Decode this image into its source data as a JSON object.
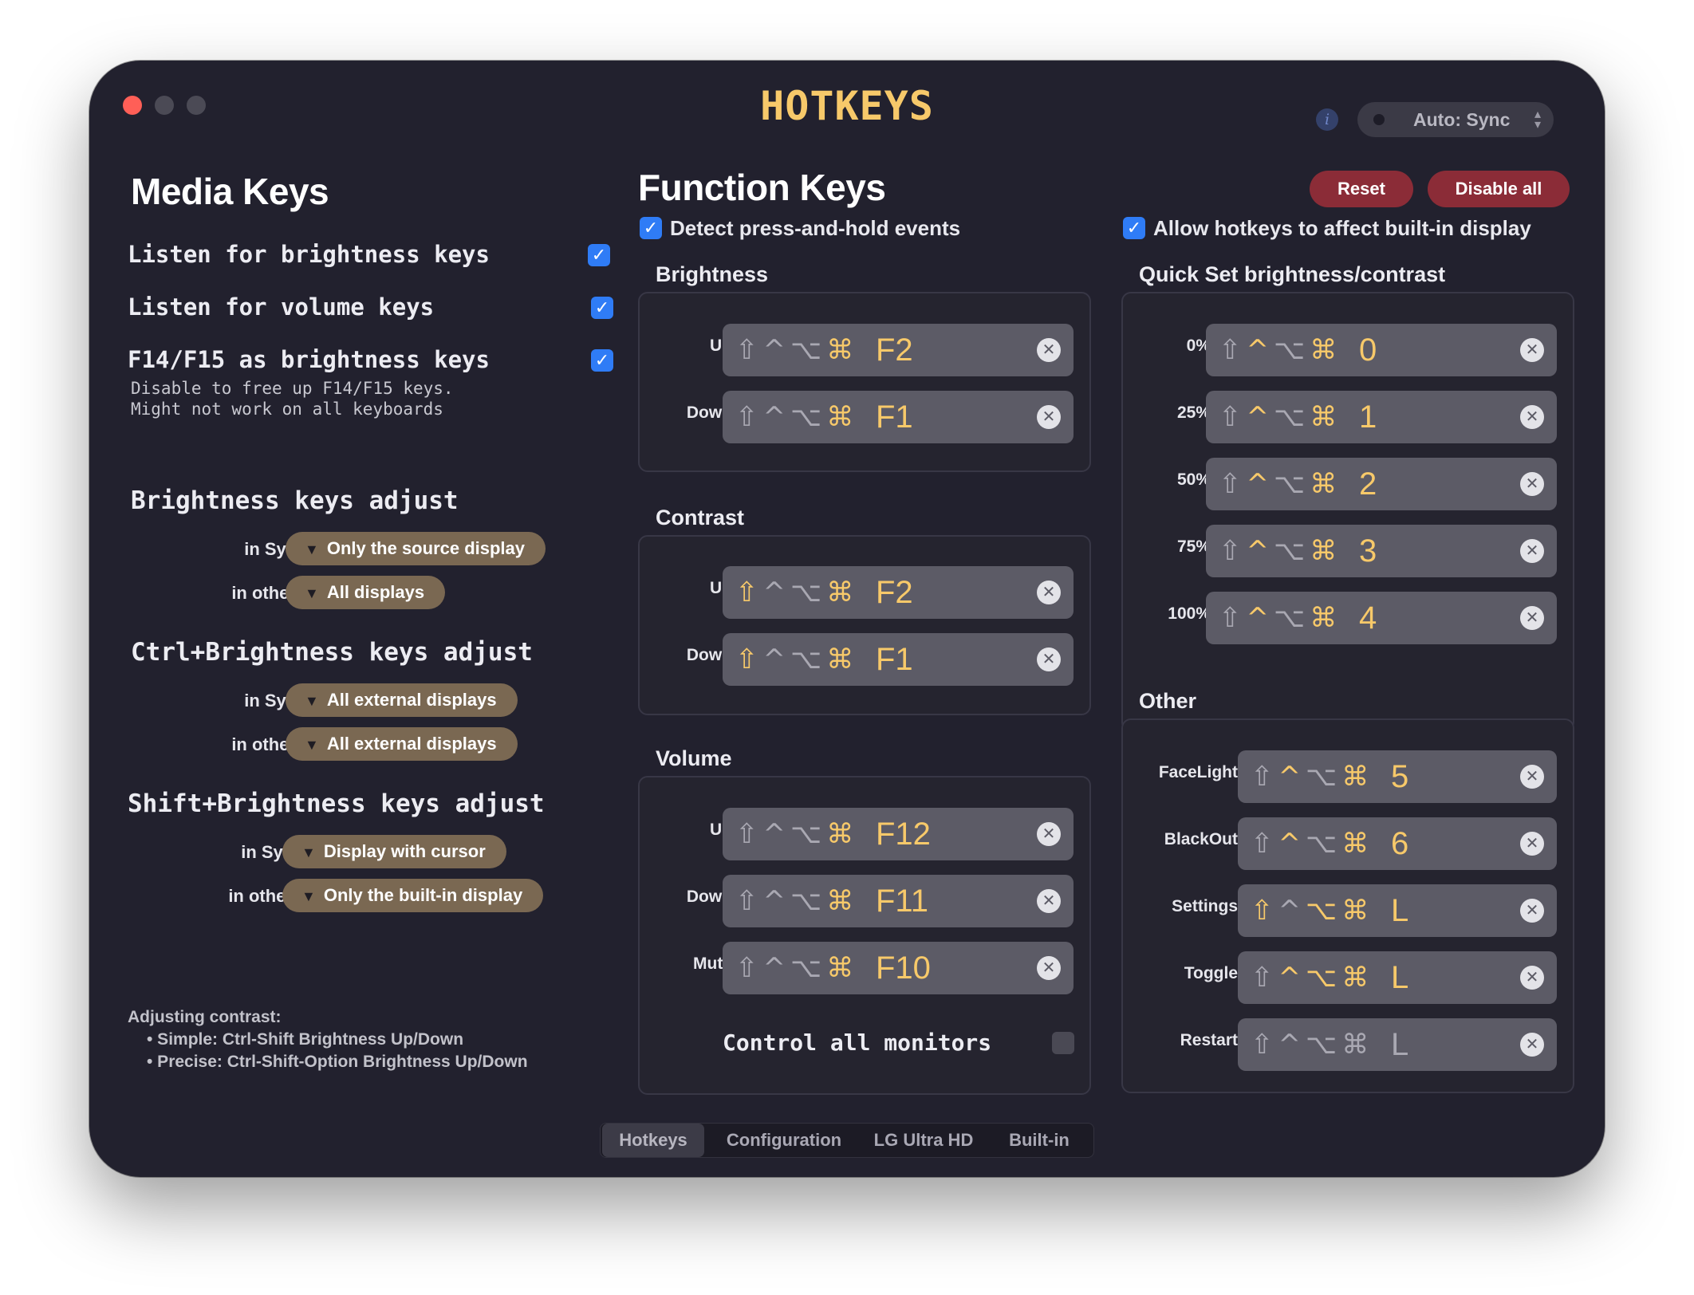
{
  "window": {
    "title": "HOTKEYS"
  },
  "toolbar": {
    "sync_mode": "Auto: Sync",
    "info_icon": "info-icon"
  },
  "media_keys": {
    "title": "Media Keys",
    "options": [
      {
        "label": "Listen for brightness keys",
        "checked": true
      },
      {
        "label": "Listen for volume keys",
        "checked": true
      },
      {
        "label": "F14/F15 as brightness keys",
        "checked": true
      }
    ],
    "f14_note_line1": "Disable to free up F14/F15 keys.",
    "f14_note_line2": "Might not work on all keyboards",
    "sections": [
      {
        "title": "Brightness keys adjust",
        "sync_label": "in Sync Mode",
        "sync_value": "Only the source display",
        "other_label": "in other modes",
        "other_value": "All displays"
      },
      {
        "title": "Ctrl+Brightness keys adjust",
        "sync_label": "in Sync Mode",
        "sync_value": "All external displays",
        "other_label": "in other modes",
        "other_value": "All external displays"
      },
      {
        "title": "Shift+Brightness keys adjust",
        "sync_label": "in Sync Mode",
        "sync_value": "Display with cursor",
        "other_label": "in other modes",
        "other_value": "Only the built-in display"
      }
    ],
    "contrast_note": {
      "title": "Adjusting contrast:",
      "line1": "• Simple:  Ctrl-Shift Brightness Up/Down",
      "line2": "• Precise: Ctrl-Shift-Option Brightness Up/Down"
    }
  },
  "function_keys": {
    "title": "Function Keys",
    "detect_hold": {
      "label": "Detect press-and-hold events",
      "checked": true
    },
    "allow_builtin": {
      "label": "Allow hotkeys to affect built-in display",
      "checked": true
    },
    "reset_label": "Reset",
    "disable_all_label": "Disable all",
    "brightness": {
      "title": "Brightness",
      "rows": [
        {
          "label": "Up",
          "mods": [
            false,
            false,
            false,
            true
          ],
          "key": "F2"
        },
        {
          "label": "Down",
          "mods": [
            false,
            false,
            false,
            true
          ],
          "key": "F1"
        }
      ]
    },
    "contrast": {
      "title": "Contrast",
      "rows": [
        {
          "label": "Up",
          "mods": [
            true,
            false,
            false,
            true
          ],
          "key": "F2"
        },
        {
          "label": "Down",
          "mods": [
            true,
            false,
            false,
            true
          ],
          "key": "F1"
        }
      ]
    },
    "volume": {
      "title": "Volume",
      "rows": [
        {
          "label": "Up",
          "mods": [
            false,
            false,
            false,
            true
          ],
          "key": "F12"
        },
        {
          "label": "Down",
          "mods": [
            false,
            false,
            false,
            true
          ],
          "key": "F11"
        },
        {
          "label": "Mute",
          "mods": [
            false,
            false,
            false,
            true
          ],
          "key": "F10"
        }
      ],
      "control_all": {
        "label": "Control all monitors",
        "checked": false
      }
    },
    "quick_set": {
      "title": "Quick Set brightness/contrast",
      "rows": [
        {
          "label": "0%",
          "mods": [
            false,
            true,
            false,
            true
          ],
          "key": "0"
        },
        {
          "label": "25%",
          "mods": [
            false,
            true,
            false,
            true
          ],
          "key": "1"
        },
        {
          "label": "50%",
          "mods": [
            false,
            true,
            false,
            true
          ],
          "key": "2"
        },
        {
          "label": "75%",
          "mods": [
            false,
            true,
            false,
            true
          ],
          "key": "3"
        },
        {
          "label": "100%",
          "mods": [
            false,
            true,
            false,
            true
          ],
          "key": "4"
        }
      ]
    },
    "other": {
      "title": "Other",
      "rows": [
        {
          "label": "FaceLight",
          "mods": [
            false,
            true,
            false,
            true
          ],
          "key": "5"
        },
        {
          "label": "BlackOut",
          "mods": [
            false,
            true,
            false,
            true
          ],
          "key": "6"
        },
        {
          "label": "Settings",
          "mods": [
            true,
            false,
            true,
            true
          ],
          "key": "L"
        },
        {
          "label": "Toggle",
          "mods": [
            false,
            true,
            true,
            true
          ],
          "key": "L"
        },
        {
          "label": "Restart",
          "mods": [
            false,
            false,
            false,
            false
          ],
          "key": "L"
        }
      ]
    }
  },
  "modifier_glyphs": [
    "⇧",
    "^",
    "⌥",
    "⌘"
  ],
  "colors": {
    "accent": "#f7c96a",
    "checkbox": "#2f7cf6",
    "danger_button": "#8b2c37",
    "pill": "#7a6852",
    "background": "#22212e"
  },
  "tabs": [
    {
      "label": "Hotkeys",
      "active": true
    },
    {
      "label": "Configuration",
      "active": false
    },
    {
      "label": "LG Ultra HD",
      "active": false
    },
    {
      "label": "Built-in",
      "active": false
    }
  ]
}
